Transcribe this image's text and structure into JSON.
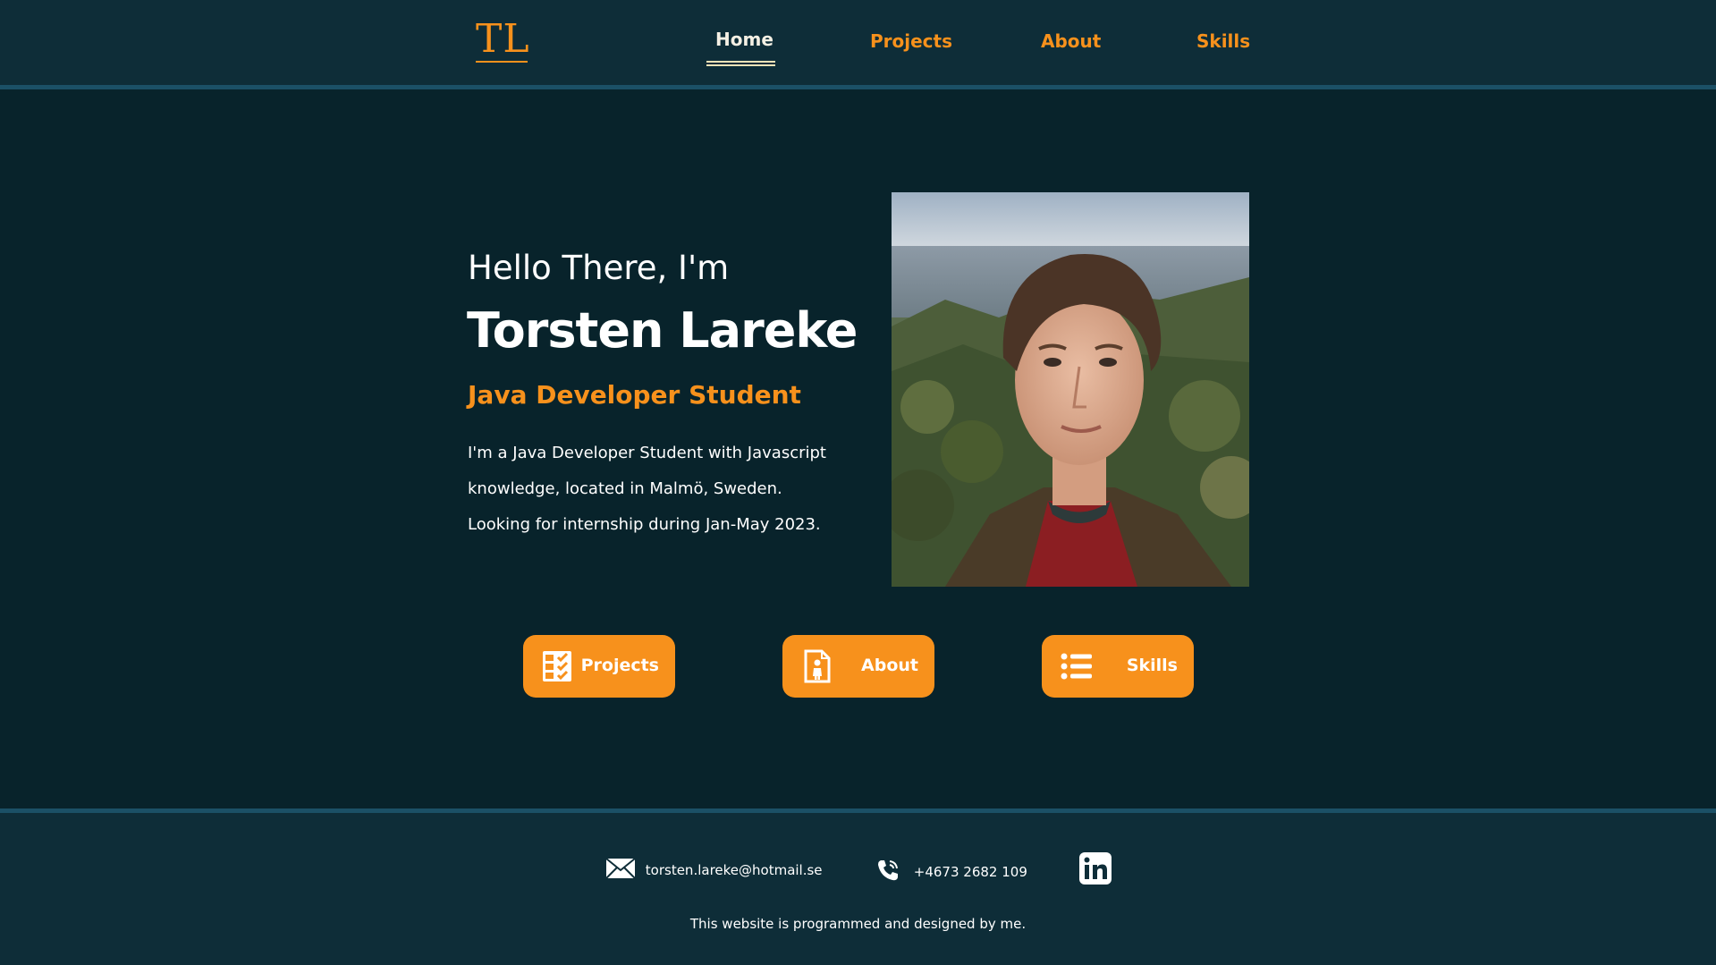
{
  "header": {
    "logo": "TL",
    "nav": [
      {
        "label": "Home",
        "active": true
      },
      {
        "label": "Projects",
        "active": false
      },
      {
        "label": "About",
        "active": false
      },
      {
        "label": "Skills",
        "active": false
      }
    ]
  },
  "hero": {
    "greeting": "Hello There, I'm",
    "name": "Torsten Lareke",
    "role": "Java Developer Student",
    "bio_lines": [
      "I'm a Java Developer Student with Javascript",
      "knowledge, located in Malmö, Sweden.",
      "Looking for internship during Jan-May 2023."
    ]
  },
  "buttons": [
    {
      "label": "Projects",
      "icon": "checklist-icon"
    },
    {
      "label": "About",
      "icon": "person-document-icon"
    },
    {
      "label": "Skills",
      "icon": "list-icon"
    }
  ],
  "footer": {
    "email": "torsten.lareke@hotmail.se",
    "phone": "+4673 2682 109",
    "linkedin_icon": "linkedin-icon",
    "credit": "This website is programmed and designed by me."
  },
  "colors": {
    "accent": "#f7911c",
    "background": "#08232b",
    "header_bg": "#0e2d38",
    "border": "#1b5066"
  }
}
